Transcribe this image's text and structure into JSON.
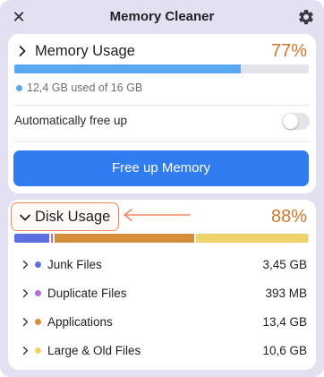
{
  "window": {
    "title": "Memory Cleaner",
    "close_icon": "close-icon",
    "settings_icon": "gear-icon"
  },
  "memory": {
    "title": "Memory Usage",
    "percent": "77%",
    "used_fraction": 0.77,
    "note": "12,4 GB used of 16 GB",
    "auto_label": "Automatically free up",
    "auto_enabled": false,
    "button_label": "Free up Memory"
  },
  "disk": {
    "title": "Disk Usage",
    "percent": "88%",
    "segments": [
      {
        "name": "Junk Files",
        "fraction": 0.124,
        "color": "#5b6fe0"
      },
      {
        "name": "Duplicate Files",
        "fraction": 0.014,
        "color": "#b26ee0"
      },
      {
        "name": "Applications",
        "fraction": 0.478,
        "color": "#d48e3a"
      },
      {
        "name": "Large & Old Files",
        "fraction": 0.38,
        "color": "#efd36a"
      }
    ],
    "rows": [
      {
        "label": "Junk Files",
        "size": "3,45 GB",
        "color": "#5b6fe0"
      },
      {
        "label": "Duplicate Files",
        "size": "393 MB",
        "color": "#b26ee0"
      },
      {
        "label": "Applications",
        "size": "13,4 GB",
        "color": "#d48e3a"
      },
      {
        "label": "Large & Old Files",
        "size": "10,6 GB",
        "color": "#efd36a"
      }
    ]
  },
  "colors": {
    "accent_blue": "#2f7cf0",
    "memory_bar": "#5aa9f0",
    "percent_orange": "#d4772b",
    "highlight": "#f0885f"
  }
}
